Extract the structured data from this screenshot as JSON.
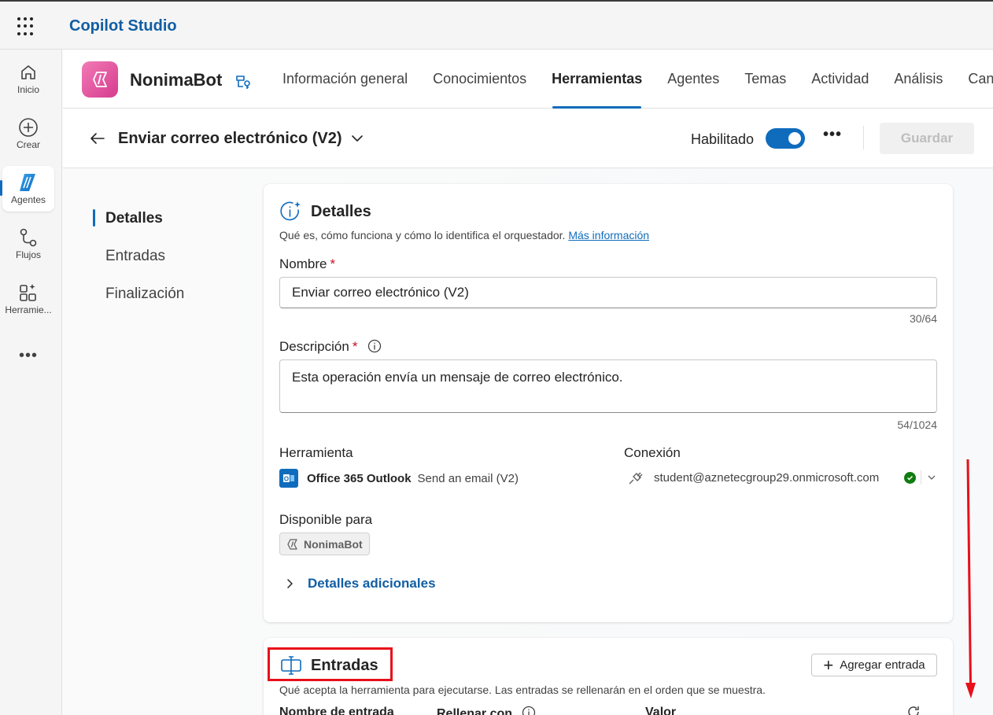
{
  "app": {
    "title": "Copilot Studio"
  },
  "rail": {
    "items": [
      {
        "label": "Inicio",
        "icon": "home-icon"
      },
      {
        "label": "Crear",
        "icon": "plus-circle-icon"
      },
      {
        "label": "Agentes",
        "icon": "agents-icon"
      },
      {
        "label": "Flujos",
        "icon": "flows-icon"
      },
      {
        "label": "Herramie...",
        "icon": "tools-icon"
      }
    ],
    "more": "•••"
  },
  "bot": {
    "name": "NonimaBot"
  },
  "tabs": [
    {
      "label": "Información general"
    },
    {
      "label": "Conocimientos"
    },
    {
      "label": "Herramientas"
    },
    {
      "label": "Agentes"
    },
    {
      "label": "Temas"
    },
    {
      "label": "Actividad"
    },
    {
      "label": "Análisis"
    },
    {
      "label": "Canales"
    }
  ],
  "toolbar": {
    "title": "Enviar correo electrónico (V2)",
    "enabled_label": "Habilitado",
    "enabled": true,
    "more": "•••",
    "save_label": "Guardar"
  },
  "leftnav": [
    {
      "label": "Detalles"
    },
    {
      "label": "Entradas"
    },
    {
      "label": "Finalización"
    }
  ],
  "details": {
    "title": "Detalles",
    "subtitle": "Qué es, cómo funciona y cómo lo identifica el orquestador.",
    "learn_more": "Más información",
    "name_label": "Nombre",
    "required_mark": "*",
    "name_value": "Enviar correo electrónico (V2)",
    "name_counter": "30/64",
    "description_label": "Descripción",
    "description_value": "Esta operación envía un mensaje de correo electrónico.",
    "description_counter": "54/1024",
    "tool_label": "Herramienta",
    "tool_connector": "Office 365 Outlook",
    "tool_action": "Send an email (V2)",
    "connection_label": "Conexión",
    "connection_value": "student@aznetecgroup29.onmicrosoft.com",
    "available_label": "Disponible para",
    "available_value": "NonimaBot",
    "additional_label": "Detalles adicionales"
  },
  "inputs": {
    "title": "Entradas",
    "subtitle": "Qué acepta la herramienta para ejecutarse. Las entradas se rellenarán en el orden que se muestra.",
    "add_label": "Agregar entrada",
    "col_name": "Nombre de entrada",
    "col_fill": "Rellenar con",
    "col_value": "Valor"
  },
  "colors": {
    "accent": "#0f6cbd",
    "brand_title": "#115ea3",
    "bot_gradient_start": "#f27ab6",
    "bot_gradient_end": "#d63c8e",
    "required": "#c50f1f",
    "success": "#107c10",
    "annotation": "#e8101a"
  }
}
